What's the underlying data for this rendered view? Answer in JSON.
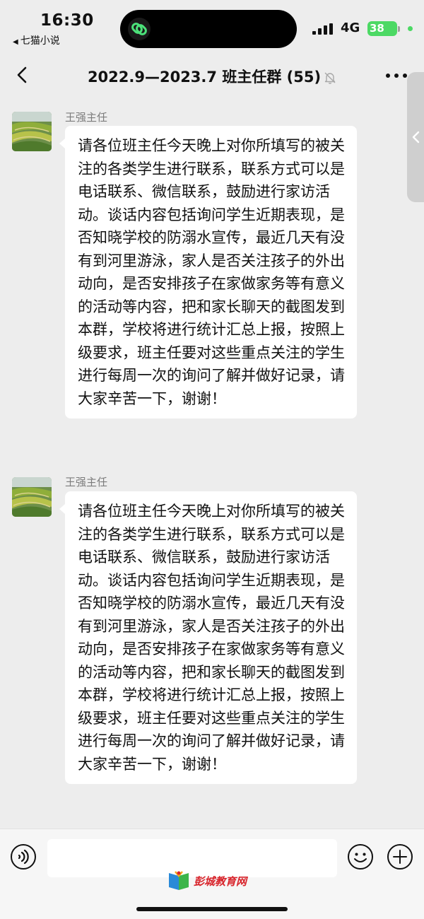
{
  "status_bar": {
    "time": "16:30",
    "back_app_label": "七猫小说",
    "network": "4G",
    "battery": "38"
  },
  "nav": {
    "title": "2022.9—2023.7 班主任群 (55)",
    "icons": {
      "back": "chevron-left-icon",
      "mute": "bell-off-icon",
      "more": "more-dots-icon"
    }
  },
  "messages": [
    {
      "sender": "王强主任",
      "text": "请各位班主任今天晚上对你所填写的被关注的各类学生进行联系，联系方式可以是电话联系、微信联系，鼓励进行家访活动。谈话内容包括询问学生近期表现，是否知晓学校的防溺水宣传，最近几天有没有到河里游泳，家人是否关注孩子的外出动向，是否安排孩子在家做家务等有意义的活动等内容，把和家长聊天的截图发到本群，学校将进行统计汇总上报，按照上级要求，班主任要对这些重点关注的学生进行每周一次的询问了解并做好记录，请大家辛苦一下，谢谢！"
    },
    {
      "sender": "王强主任",
      "text": "请各位班主任今天晚上对你所填写的被关注的各类学生进行联系，联系方式可以是电话联系、微信联系，鼓励进行家访活动。谈话内容包括询问学生近期表现，是否知晓学校的防溺水宣传，最近几天有没有到河里游泳，家人是否关注孩子的外出动向，是否安排孩子在家做家务等有意义的活动等内容，把和家长聊天的截图发到本群，学校将进行统计汇总上报，按照上级要求，班主任要对这些重点关注的学生进行每周一次的询问了解并做好记录，请大家辛苦一下，谢谢！"
    }
  ],
  "input_bar": {
    "value": "",
    "icons": {
      "voice": "voice-icon",
      "emoji": "emoji-icon",
      "plus": "plus-icon"
    },
    "watermark": "彭城教育网"
  },
  "colors": {
    "background": "#ededed",
    "bubble": "#ffffff",
    "battery": "#4cd964",
    "watermark": "#d8232a"
  }
}
